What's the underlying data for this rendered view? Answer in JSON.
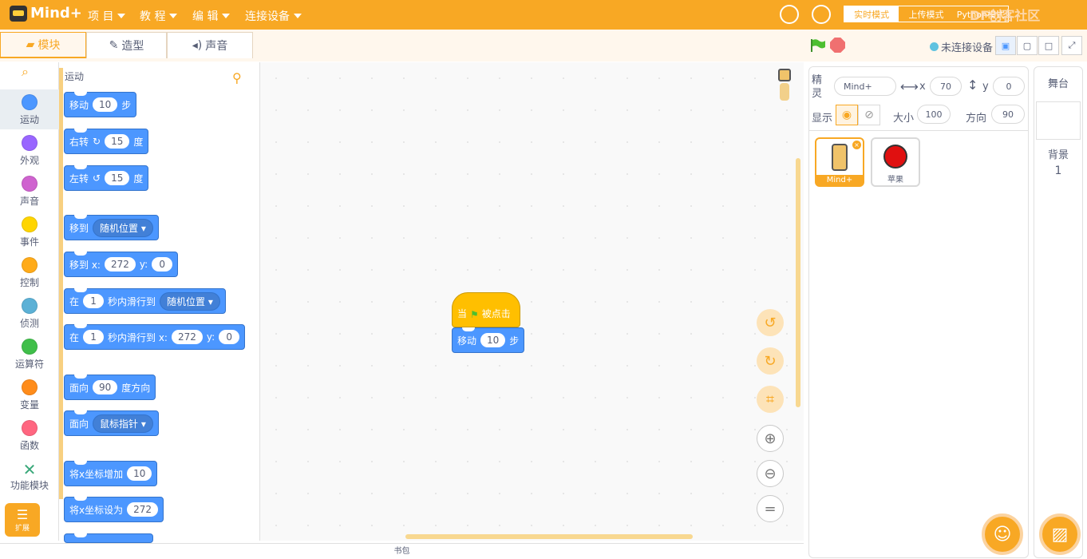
{
  "app": {
    "name": "Mind+"
  },
  "menu": {
    "project": "项 目",
    "tutorial": "教 程",
    "edit": "编 辑",
    "connect": "连接设备"
  },
  "modes": {
    "realtime": "实时模式",
    "upload": "上传模式",
    "python": "Python模式"
  },
  "watermark": "DF创客社区",
  "tabs": {
    "blocks": "模块",
    "costumes": "造型",
    "sounds": "声音"
  },
  "status": {
    "device": "未连接设备"
  },
  "categories": [
    {
      "label": "运动",
      "color": "#4c97ff"
    },
    {
      "label": "外观",
      "color": "#9966ff"
    },
    {
      "label": "声音",
      "color": "#cf63cf"
    },
    {
      "label": "事件",
      "color": "#ffd500"
    },
    {
      "label": "控制",
      "color": "#ffab19"
    },
    {
      "label": "侦测",
      "color": "#5cb1d6"
    },
    {
      "label": "运算符",
      "color": "#40bf4a"
    },
    {
      "label": "变量",
      "color": "#ff8c1a"
    },
    {
      "label": "函数",
      "color": "#ff6680"
    },
    {
      "label": "功能模块",
      "color": ""
    }
  ],
  "extension_label": "扩展",
  "palette": {
    "title": "运动",
    "move": {
      "a": "移动",
      "v": "10",
      "b": "步"
    },
    "turn_right": {
      "a": "右转",
      "v": "15",
      "b": "度"
    },
    "turn_left": {
      "a": "左转",
      "v": "15",
      "b": "度"
    },
    "goto": {
      "a": "移到",
      "dd": "随机位置"
    },
    "goto_xy": {
      "a": "移到 x:",
      "x": "272",
      "b": "y:",
      "y": "0"
    },
    "glide": {
      "a": "在",
      "v": "1",
      "b": "秒内滑行到",
      "dd": "随机位置"
    },
    "glide_xy": {
      "a": "在",
      "v": "1",
      "b": "秒内滑行到 x:",
      "x": "272",
      "c": "y:",
      "y": "0"
    },
    "point_dir": {
      "a": "面向",
      "v": "90",
      "b": "度方向"
    },
    "point_towards": {
      "a": "面向",
      "dd": "鼠标指针"
    },
    "change_x": {
      "a": "将x坐标增加",
      "v": "10"
    },
    "set_x": {
      "a": "将x坐标设为",
      "v": "272"
    }
  },
  "script": {
    "hat": {
      "a": "当",
      "b": "被点击"
    },
    "move": {
      "a": "移动",
      "v": "10",
      "b": "步"
    }
  },
  "backpack": "书包",
  "sprite": {
    "name_label": "精灵",
    "name": "Mind+",
    "x_label": "x",
    "x": "70",
    "y_label": "y",
    "y": "0",
    "show_label": "显示",
    "size_label": "大小",
    "size": "100",
    "dir_label": "方向",
    "dir": "90",
    "tiles": [
      {
        "name": "Mind+"
      },
      {
        "name": "苹果"
      }
    ]
  },
  "stage": {
    "title": "舞台",
    "bg_label": "背景",
    "bg_count": "1"
  }
}
